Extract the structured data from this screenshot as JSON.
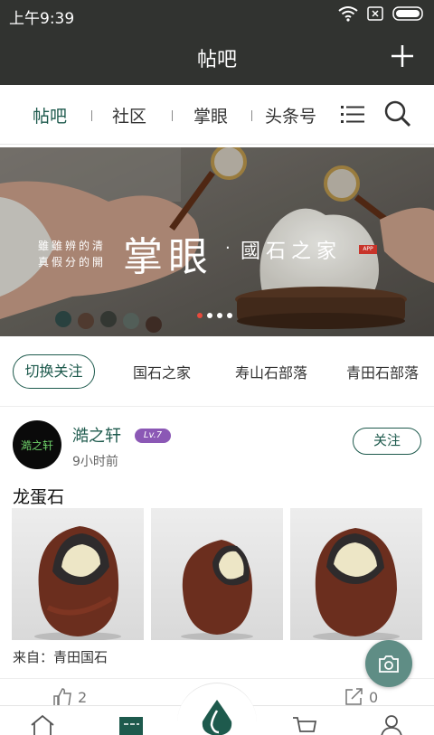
{
  "status_bar": {
    "time": "上午9:39"
  },
  "header": {
    "title": "帖吧",
    "add_icon": "plus-icon"
  },
  "tabs": [
    {
      "label": "帖吧",
      "active": true
    },
    {
      "label": "社区",
      "active": false
    },
    {
      "label": "掌眼",
      "active": false
    },
    {
      "label": "头条号",
      "active": false
    }
  ],
  "banner": {
    "poem_line1": "雖雖辨的清",
    "poem_line2": "真假分的開",
    "headline": "掌眼",
    "subtitle": "國石之家",
    "seal": "APP",
    "slide_count": 4,
    "active_slide": 1
  },
  "channels": {
    "switch_label": "切换关注",
    "items": [
      "国石之家",
      "寿山石部落",
      "青田石部落"
    ]
  },
  "post": {
    "avatar_text": "澔之轩",
    "username": "澔之轩",
    "level": "Lv.7",
    "time": "9小时前",
    "follow_label": "关注",
    "title": "龙蛋石",
    "source": "来自：青田国石",
    "likes": "2",
    "shares": "0"
  },
  "colors": {
    "accent": "#1e5a4d",
    "dark_bar": "#313330",
    "level_badge": "#8b58b5",
    "fab": "#5f8d85"
  },
  "bottom_nav": [
    "home-icon",
    "forum-icon",
    "water-drop-logo-icon",
    "cart-icon",
    "user-icon"
  ]
}
